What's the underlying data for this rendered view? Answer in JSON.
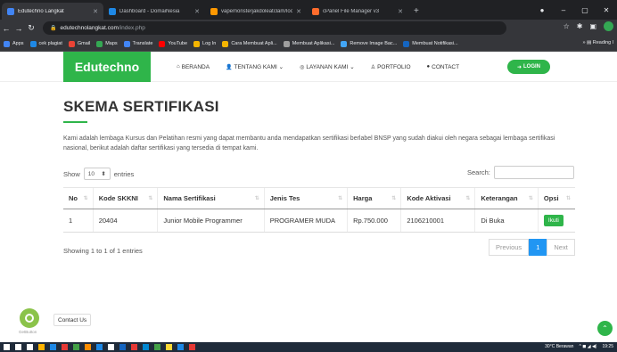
{
  "browser": {
    "tabs": [
      {
        "label": "Edutechno Langkat",
        "color": "#4285f4",
        "active": true
      },
      {
        "label": "Dashboard - DomaiNesia",
        "color": "#1e88e5",
        "active": false
      },
      {
        "label": "vapemonsterjakdoleatclam/localh...",
        "color": "#ff9800",
        "active": false
      },
      {
        "label": "cPanel File Manager v3",
        "color": "#ff6c2c",
        "active": false
      }
    ],
    "url_domain": "edutechnolangkat.com",
    "url_path": "/index.php",
    "bookmarks": [
      {
        "label": "Apps",
        "color": "#4285f4"
      },
      {
        "label": "cek plagiat",
        "color": "#1e88e5"
      },
      {
        "label": "Gmail",
        "color": "#ea4335"
      },
      {
        "label": "Maps",
        "color": "#34a853"
      },
      {
        "label": "Translate",
        "color": "#4285f4"
      },
      {
        "label": "YouTube",
        "color": "#ff0000"
      },
      {
        "label": "Log In",
        "color": "#f4b400"
      },
      {
        "label": "Cara Membuat Apli...",
        "color": "#f4b400"
      },
      {
        "label": "Membuat Aplikasi...",
        "color": "#9e9e9e"
      },
      {
        "label": "Remove Image Bac...",
        "color": "#42a5f5"
      },
      {
        "label": "Membuat Notifikasi...",
        "color": "#1565c0"
      }
    ],
    "reading_list": "Reading l"
  },
  "site": {
    "brand": "Edutechno",
    "accent": "#2fb54a",
    "nav": [
      {
        "icon": "home-icon",
        "glyph": "⌂",
        "label": "BERANDA"
      },
      {
        "icon": "user-icon",
        "glyph": "👤",
        "label": "TENTANG KAMI ⌄"
      },
      {
        "icon": "handshake-icon",
        "glyph": "◎",
        "label": "LAYANAN KAMI ⌄"
      },
      {
        "icon": "portfolio-icon",
        "glyph": "♙",
        "label": "PORTFOLIO"
      },
      {
        "icon": "chat-icon",
        "glyph": "●",
        "label": "CONTACT"
      }
    ],
    "login": "LOGIN"
  },
  "main": {
    "title": "SKEMA SERTIFIKASI",
    "description": "Kami adalah lembaga Kursus dan Pelatihan resmi yang dapat membantu anda mendapatkan sertifikasi berlabel BNSP yang sudah diakui oleh negara sebagai lembaga sertifikasi nasional, berikut adalah daftar sertifikasi yang tersedia di tempat kami.",
    "show_label": "Show",
    "show_value": "10",
    "entries_label": "entries",
    "search_label": "Search:",
    "columns": [
      "No",
      "Kode SKKNI",
      "Nama Sertifikasi",
      "Jenis Tes",
      "Harga",
      "Kode Aktivasi",
      "Keterangan",
      "Opsi"
    ],
    "rows": [
      {
        "no": "1",
        "kode": "20404",
        "nama": "Junior Mobile Programmer",
        "jenis": "PROGRAMER MUDA",
        "harga": "Rp.750.000",
        "aktivasi": "2106210001",
        "ket": "Di Buka",
        "opsi": "Ikuti"
      }
    ],
    "info": "Showing 1 to 1 of 1 entries",
    "pager": {
      "prev": "Previous",
      "current": "1",
      "next": "Next"
    }
  },
  "floating": {
    "contact": "Contact Us",
    "getbutton": "GetButton"
  },
  "taskbar": {
    "weather": "30°C  Berawan",
    "time": "19:25"
  }
}
